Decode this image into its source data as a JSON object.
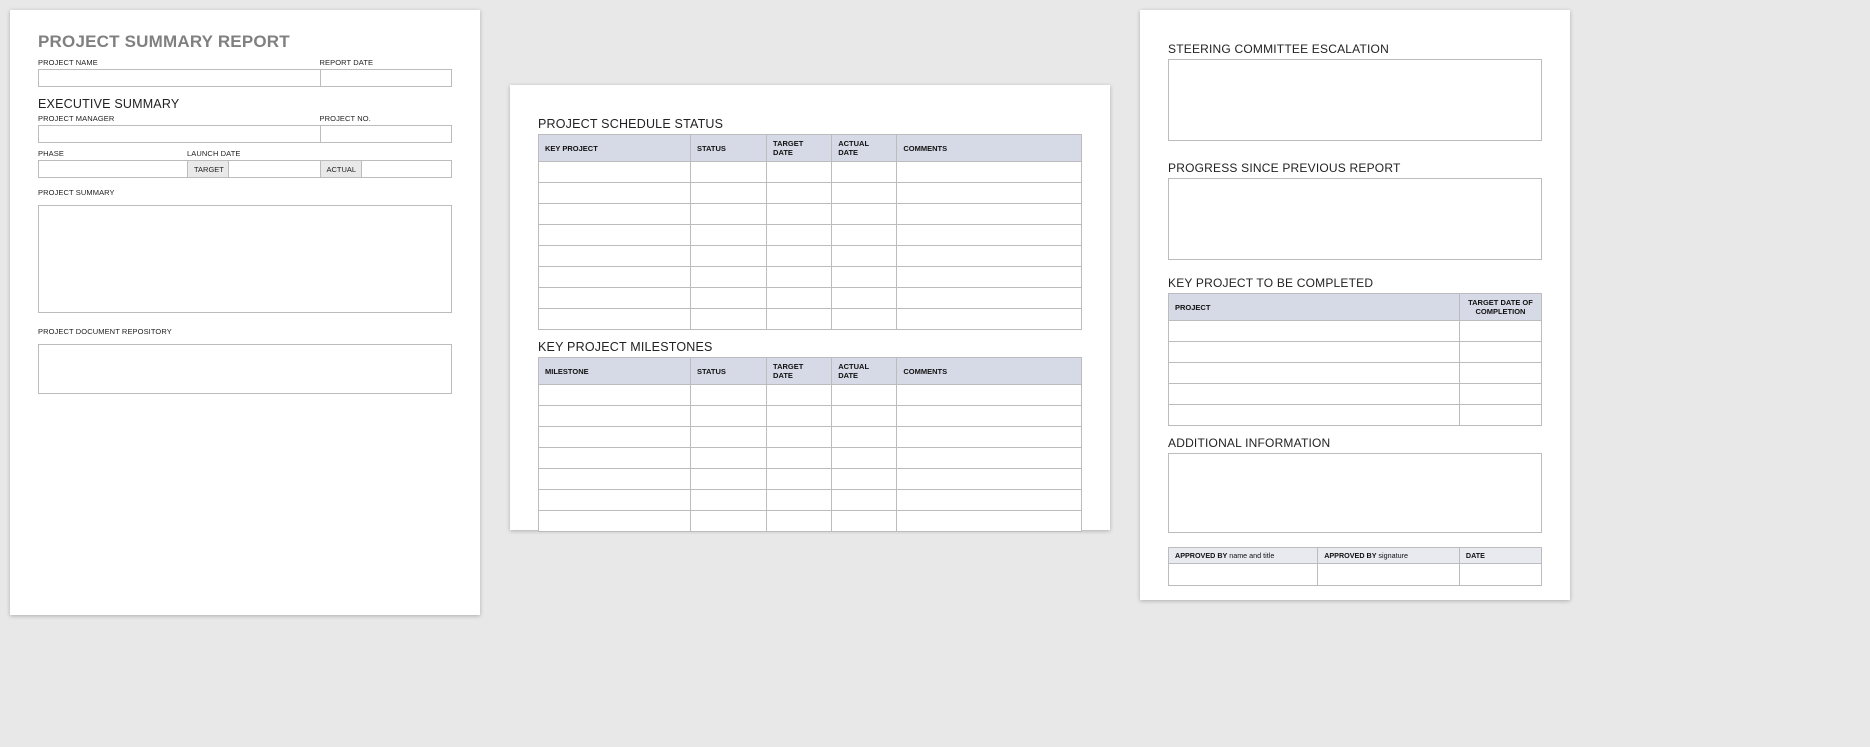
{
  "page1": {
    "title": "PROJECT SUMMARY REPORT",
    "labels": {
      "project_name": "PROJECT NAME",
      "report_date": "REPORT DATE",
      "executive_summary": "EXECUTIVE SUMMARY",
      "project_manager": "PROJECT MANAGER",
      "project_no": "PROJECT NO.",
      "phase": "PHASE",
      "launch_date": "LAUNCH DATE",
      "target": "TARGET",
      "actual": "ACTUAL",
      "project_summary": "PROJECT SUMMARY",
      "project_doc_repo": "PROJECT DOCUMENT REPOSITORY"
    }
  },
  "page2": {
    "schedule_title": "PROJECT SCHEDULE STATUS",
    "schedule_headers": {
      "key_project": "KEY PROJECT",
      "status": "STATUS",
      "target_date": "TARGET DATE",
      "actual_date": "ACTUAL DATE",
      "comments": "COMMENTS"
    },
    "milestones_title": "KEY PROJECT MILESTONES",
    "milestone_headers": {
      "milestone": "MILESTONE",
      "status": "STATUS",
      "target_date": "TARGET DATE",
      "actual_date": "ACTUAL DATE",
      "comments": "COMMENTS"
    }
  },
  "page3": {
    "labels": {
      "steering": "STEERING COMMITTEE ESCALATION",
      "progress": "PROGRESS SINCE PREVIOUS REPORT",
      "key_project_complete": "KEY PROJECT TO BE COMPLETED",
      "project": "PROJECT",
      "target_completion": "TARGET DATE OF COMPLETION",
      "additional_info": "ADDITIONAL INFORMATION",
      "approved_by": "APPROVED BY",
      "name_title": "name and title",
      "signature": "signature",
      "date": "DATE"
    }
  }
}
